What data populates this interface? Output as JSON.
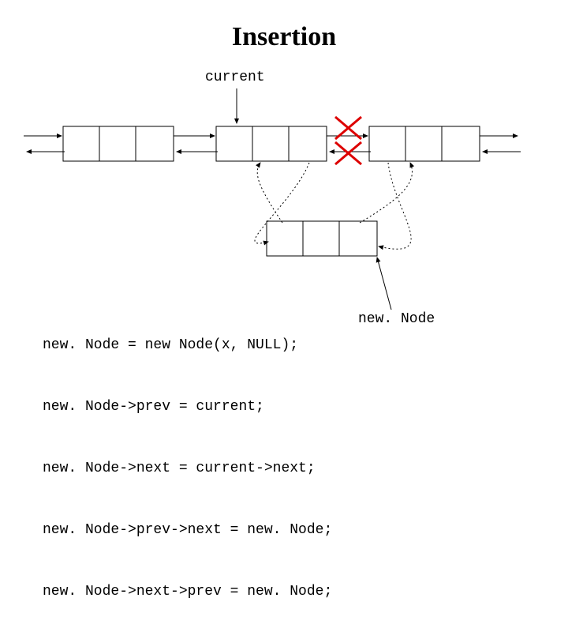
{
  "title": "Insertion",
  "current_label": "current",
  "newnode_label": "new. Node",
  "code": {
    "l1": "new. Node = new Node(x, NULL);",
    "l2": "new. Node->prev = current;",
    "l3": "new. Node->next = current->next;",
    "l4": "new. Node->prev->next = new. Node;",
    "l5": "new. Node->next->prev = new. Node;"
  },
  "diagram": {
    "nodes": [
      {
        "role": "left-node"
      },
      {
        "role": "current-node"
      },
      {
        "role": "right-node"
      },
      {
        "role": "new-node"
      }
    ],
    "pointer_labels": [
      "current",
      "newNode"
    ],
    "crossed_out_links": 2
  }
}
